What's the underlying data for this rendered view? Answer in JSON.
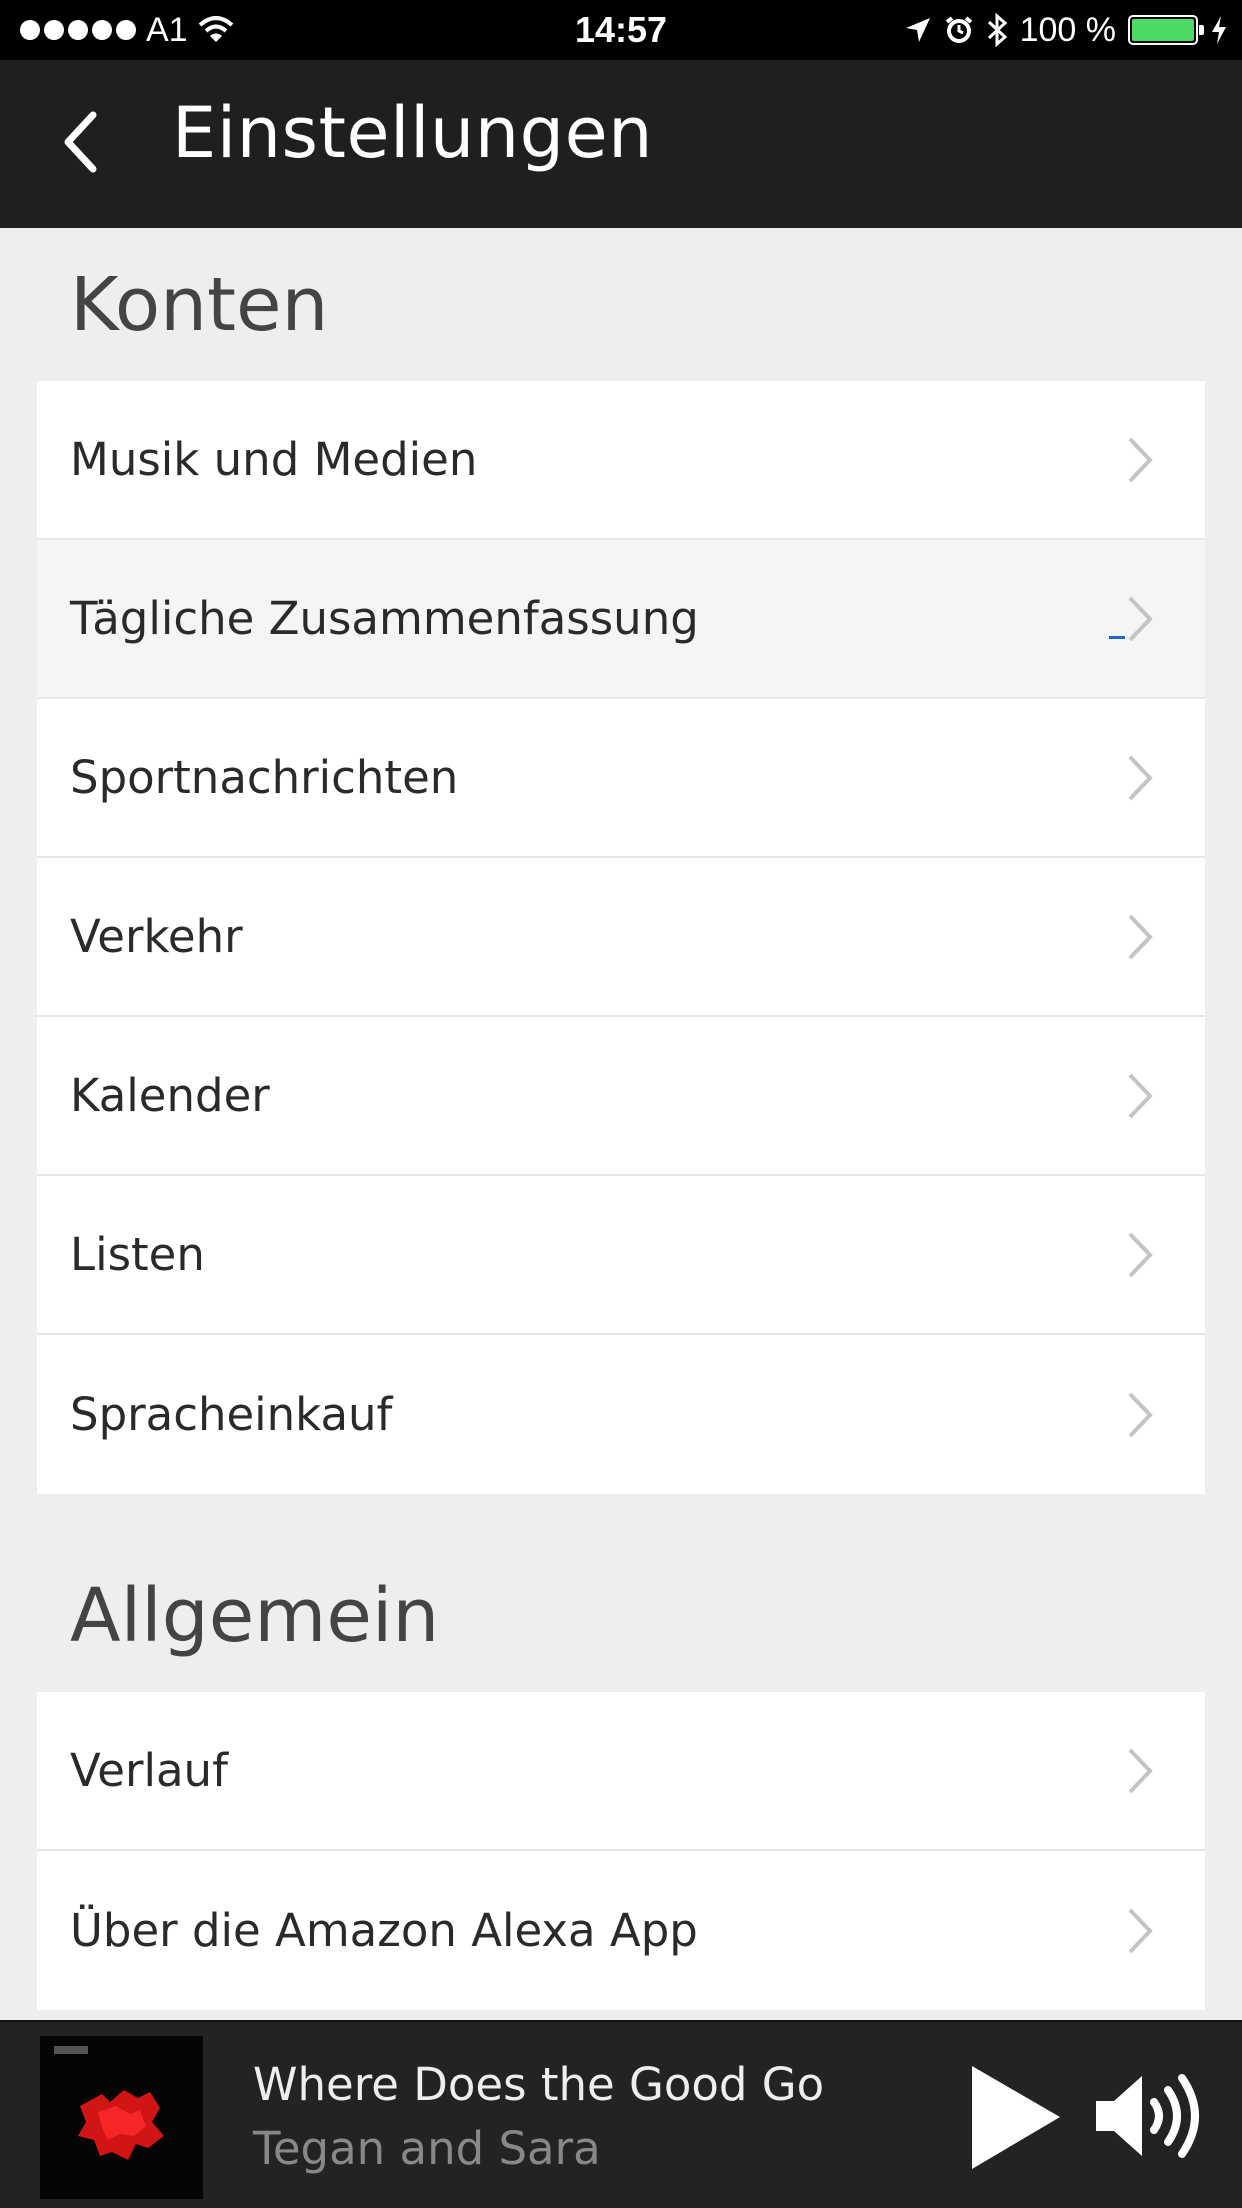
{
  "status_bar": {
    "carrier": "A1",
    "time": "14:57",
    "battery": "100 %",
    "icons": [
      "signal-dots-icon",
      "wifi-icon",
      "location-arrow-icon",
      "alarm-icon",
      "bluetooth-icon",
      "battery-icon",
      "charging-bolt-icon"
    ],
    "battery_color": "#4cd964"
  },
  "header": {
    "title": "Einstellungen",
    "back_icon": "chevron-left-icon"
  },
  "sections": {
    "accounts": {
      "title": "Konten",
      "items": [
        {
          "label": "Musik und Medien"
        },
        {
          "label": "Tägliche Zusammenfassung"
        },
        {
          "label": "Sportnachrichten"
        },
        {
          "label": "Verkehr"
        },
        {
          "label": "Kalender"
        },
        {
          "label": "Listen"
        },
        {
          "label": "Spracheinkauf"
        }
      ]
    },
    "general": {
      "title": "Allgemein",
      "items": [
        {
          "label": "Verlauf"
        },
        {
          "label": "Über die Amazon Alexa App"
        }
      ]
    }
  },
  "player": {
    "track_title": "Where Does the Good Go",
    "artist": "Tegan and Sara",
    "play_icon": "play-icon",
    "volume_icon": "volume-icon"
  }
}
